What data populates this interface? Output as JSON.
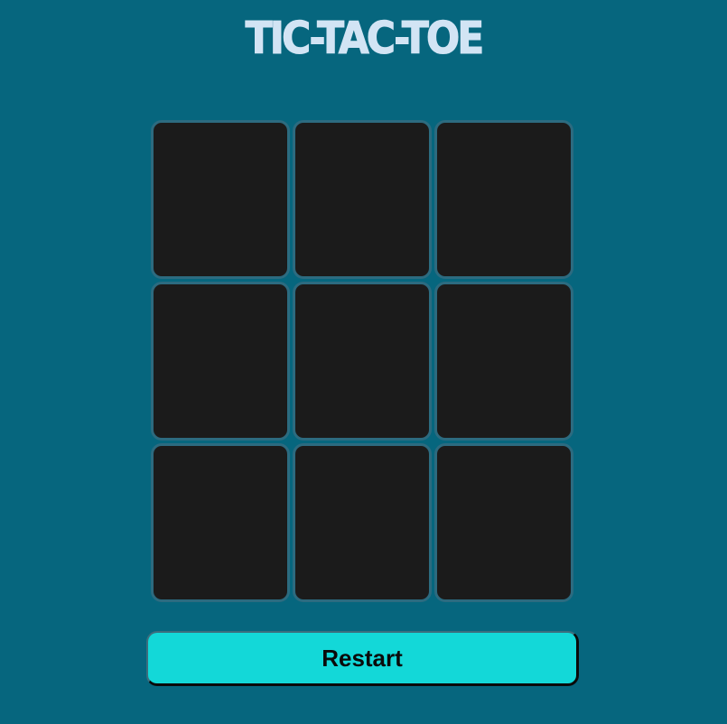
{
  "title": "TIC-TAC-TOE",
  "board": {
    "cells": [
      "",
      "",
      "",
      "",
      "",
      "",
      "",
      "",
      ""
    ]
  },
  "controls": {
    "restart_label": "Restart"
  },
  "colors": {
    "background": "#06667e",
    "cell_fill": "#1b1b1b",
    "cell_border": "#2c6b80",
    "title_text": "#d2e4f4",
    "button_fill": "#13d8d8"
  }
}
